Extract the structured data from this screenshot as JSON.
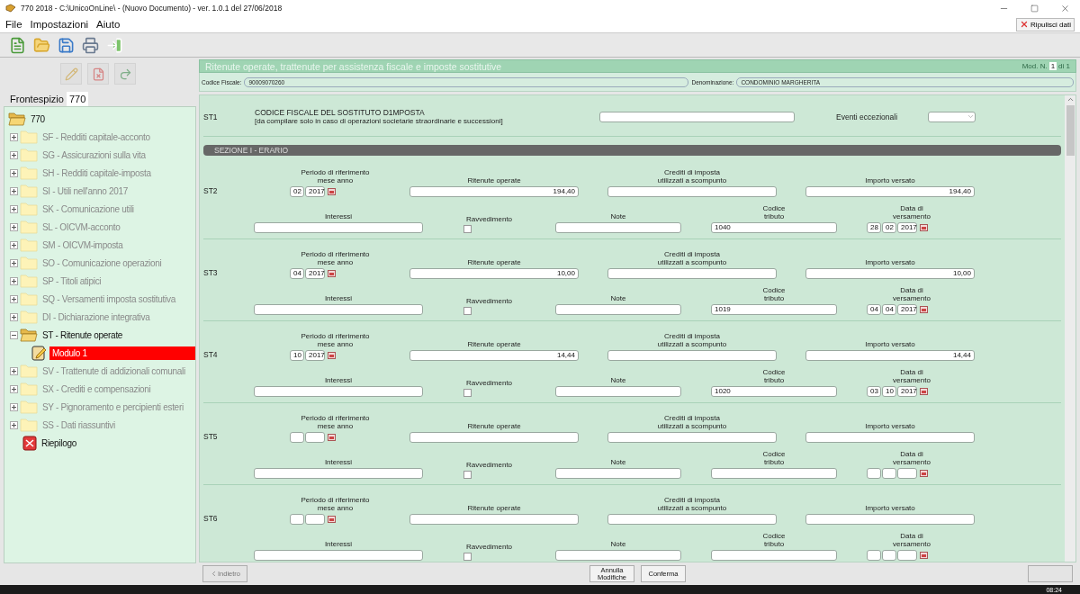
{
  "window": {
    "title": "770 2018 - C:\\UnicoOnLine\\ - (Nuovo Documento)  -  ver. 1.0.1 del 27/06/2018"
  },
  "menu": [
    "File",
    "Impostazioni",
    "Aiuto"
  ],
  "clear_button": "Ripulisci dati",
  "left_tabs": [
    {
      "label": "Frontespizio",
      "selected": false
    },
    {
      "label": "770",
      "selected": true
    }
  ],
  "tree": {
    "items": [
      {
        "kind": "folder",
        "label": "770",
        "expanded": true,
        "active": true,
        "selected": false,
        "children": [
          {
            "kind": "folder",
            "label": "SF - Redditi capitale-acconto",
            "expanded": false,
            "active": false,
            "selected": false
          },
          {
            "kind": "folder",
            "label": "SG - Assicurazioni sulla vita",
            "expanded": false,
            "active": false,
            "selected": false
          },
          {
            "kind": "folder",
            "label": "SH - Redditi capitale-imposta",
            "expanded": false,
            "active": false,
            "selected": false
          },
          {
            "kind": "folder",
            "label": "SI - Utili nell'anno 2017",
            "expanded": false,
            "active": false,
            "selected": false
          },
          {
            "kind": "folder",
            "label": "SK - Comunicazione utili",
            "expanded": false,
            "active": false,
            "selected": false
          },
          {
            "kind": "folder",
            "label": "SL - OICVM-acconto",
            "expanded": false,
            "active": false,
            "selected": false
          },
          {
            "kind": "folder",
            "label": "SM - OICVM-imposta",
            "expanded": false,
            "active": false,
            "selected": false
          },
          {
            "kind": "folder",
            "label": "SO - Comunicazione operazioni",
            "expanded": false,
            "active": false,
            "selected": false
          },
          {
            "kind": "folder",
            "label": "SP - Titoli atipici",
            "expanded": false,
            "active": false,
            "selected": false
          },
          {
            "kind": "folder",
            "label": "SQ - Versamenti imposta sostitutiva",
            "expanded": false,
            "active": false,
            "selected": false
          },
          {
            "kind": "folder",
            "label": "DI - Dichiarazione integrativa",
            "expanded": false,
            "active": false,
            "selected": false
          },
          {
            "kind": "folder",
            "label": "ST - Ritenute operate",
            "expanded": true,
            "active": true,
            "selected": false,
            "children": [
              {
                "kind": "module",
                "label": "Modulo 1",
                "selected": true
              }
            ]
          },
          {
            "kind": "folder",
            "label": "SV - Trattenute di addizionali comunali",
            "expanded": false,
            "active": false,
            "selected": false
          },
          {
            "kind": "folder",
            "label": "SX - Crediti e compensazioni",
            "expanded": false,
            "active": false,
            "selected": false
          },
          {
            "kind": "folder",
            "label": "SY - Pignoramento e percipienti esteri",
            "expanded": false,
            "active": false,
            "selected": false
          },
          {
            "kind": "folder",
            "label": "SS - Dati riassuntivi",
            "expanded": false,
            "active": false,
            "selected": false
          },
          {
            "kind": "summary",
            "label": "Riepilogo",
            "active": true,
            "selected": false
          }
        ]
      }
    ]
  },
  "form": {
    "title": "Ritenute operate, trattenute per assistenza fiscale e imposte sostitutive",
    "module_label": "Mod. N.",
    "module_number": "1",
    "module_total": "di 1",
    "codice_fiscale_label": "Codice Fiscale:",
    "codice_fiscale": "90009070260",
    "denominazione_label": "Denominazione:",
    "denominazione": "CONDOMINIO MARGHERITA",
    "st1": {
      "code": "ST1",
      "title": "CODICE FISCALE DEL SOSTITUTO D1MPOSTA",
      "subtitle": "[da compilare solo in caso di operazioni societarie straordinarie e successioni]",
      "events_label": "Eventi eccezionali"
    },
    "section_header": "SEZIONE I - ERARIO",
    "rows": [
      {
        "code": "ST2",
        "fields": [
          {
            "kind": "period",
            "label": "Periodo di riferimento\nmese anno",
            "parts": [
              "02",
              "2017"
            ]
          },
          {
            "kind": "amount",
            "label": "Ritenute operate",
            "value": "194,40"
          },
          {
            "kind": "amount",
            "label": "Crediti di imposta\nutilizzati a scompunto"
          },
          {
            "kind": "amount",
            "label": "Importo versato",
            "value": "194,40"
          },
          {
            "kind": "amount",
            "label": "Interessi"
          },
          {
            "kind": "check",
            "label": "Ravvedimento",
            "checked": false
          },
          {
            "kind": "text",
            "label": "Note"
          },
          {
            "kind": "text",
            "label": "Codice\ntributo",
            "value": "1040"
          },
          {
            "kind": "date",
            "label": "Data di\nversamento",
            "parts": [
              "28",
              "02",
              "2017"
            ]
          }
        ]
      },
      {
        "code": "ST3",
        "fields": [
          {
            "kind": "period",
            "label": "Periodo di riferimento\nmese anno",
            "parts": [
              "04",
              "2017"
            ]
          },
          {
            "kind": "amount",
            "label": "Ritenute operate",
            "value": "10,00"
          },
          {
            "kind": "amount",
            "label": "Crediti di imposta\nutilizzati a scompunto"
          },
          {
            "kind": "amount",
            "label": "Importo versato",
            "value": "10,00"
          },
          {
            "kind": "amount",
            "label": "Interessi"
          },
          {
            "kind": "check",
            "label": "Ravvedimento",
            "checked": false
          },
          {
            "kind": "text",
            "label": "Note"
          },
          {
            "kind": "text",
            "label": "Codice\ntributo",
            "value": "1019"
          },
          {
            "kind": "date",
            "label": "Data di\nversamento",
            "parts": [
              "04",
              "04",
              "2017"
            ]
          }
        ]
      },
      {
        "code": "ST4",
        "fields": [
          {
            "kind": "period",
            "label": "Periodo di riferimento\nmese anno",
            "parts": [
              "10",
              "2017"
            ]
          },
          {
            "kind": "amount",
            "label": "Ritenute operate",
            "value": "14,44"
          },
          {
            "kind": "amount",
            "label": "Crediti di imposta\nutilizzati a scompunto"
          },
          {
            "kind": "amount",
            "label": "Importo versato",
            "value": "14,44"
          },
          {
            "kind": "amount",
            "label": "Interessi"
          },
          {
            "kind": "check",
            "label": "Ravvedimento",
            "checked": false
          },
          {
            "kind": "text",
            "label": "Note"
          },
          {
            "kind": "text",
            "label": "Codice\ntributo",
            "value": "1020"
          },
          {
            "kind": "date",
            "label": "Data di\nversamento",
            "parts": [
              "03",
              "10",
              "2017"
            ]
          }
        ]
      },
      {
        "code": "ST5",
        "fields": [
          {
            "kind": "period",
            "label": "Periodo di riferimento\nmese anno"
          },
          {
            "kind": "amount",
            "label": "Ritenute operate"
          },
          {
            "kind": "amount",
            "label": "Crediti di imposta\nutilizzati a scompunto"
          },
          {
            "kind": "amount",
            "label": "Importo versato"
          },
          {
            "kind": "amount",
            "label": "Interessi"
          },
          {
            "kind": "check",
            "label": "Ravvedimento",
            "checked": false
          },
          {
            "kind": "text",
            "label": "Note"
          },
          {
            "kind": "text",
            "label": "Codice\ntributo"
          },
          {
            "kind": "date",
            "label": "Data di\nversamento"
          }
        ]
      },
      {
        "code": "ST6",
        "fields": [
          {
            "kind": "period",
            "label": "Periodo di riferimento\nmese anno"
          },
          {
            "kind": "amount",
            "label": "Ritenute operate"
          },
          {
            "kind": "amount",
            "label": "Crediti di imposta\nutilizzati a scompunto"
          },
          {
            "kind": "amount",
            "label": "Importo versato"
          },
          {
            "kind": "amount",
            "label": "Interessi"
          },
          {
            "kind": "check",
            "label": "Ravvedimento",
            "checked": false
          },
          {
            "kind": "text",
            "label": "Note"
          },
          {
            "kind": "text",
            "label": "Codice\ntributo"
          },
          {
            "kind": "date",
            "label": "Data di\nversamento"
          }
        ]
      }
    ]
  },
  "buttons": [
    {
      "label": "Indietro",
      "disabled": true
    },
    {
      "label": "Annulla\nModifiche",
      "disabled": false
    },
    {
      "label": "Conferma",
      "disabled": false
    },
    {
      "disabled": true
    }
  ],
  "taskbar": {
    "time": "08:24"
  }
}
